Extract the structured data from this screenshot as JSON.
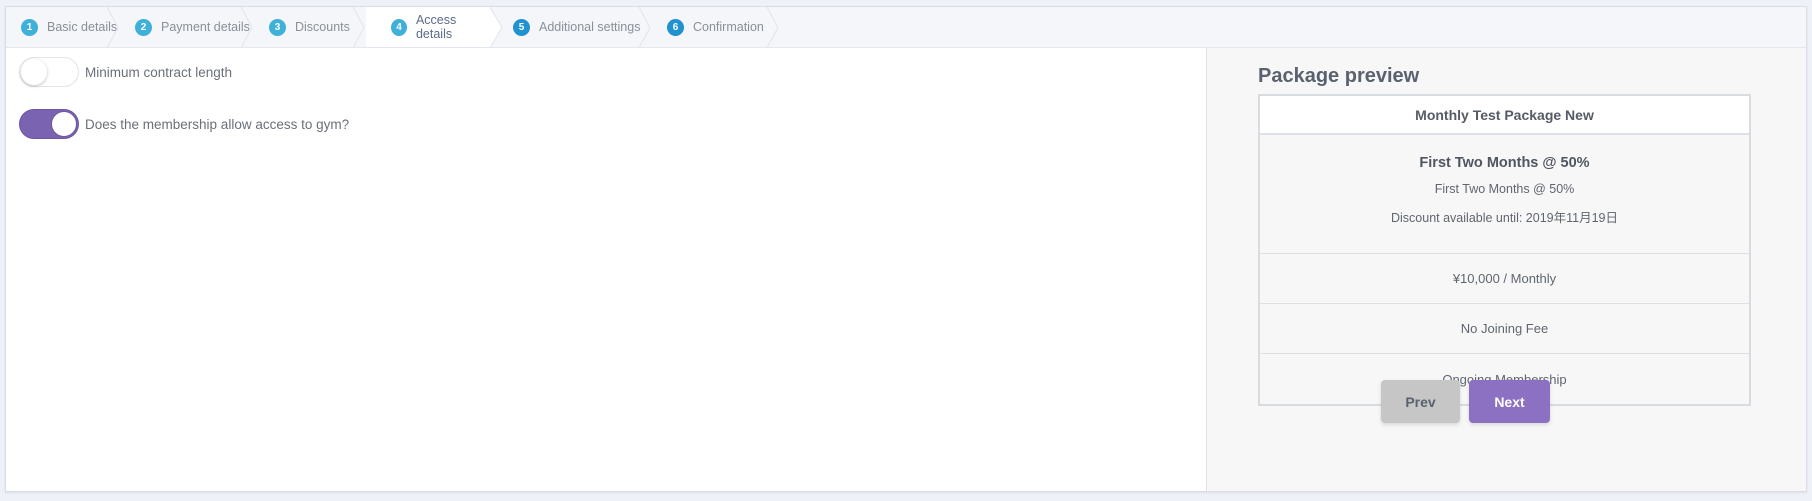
{
  "stepper": {
    "steps": [
      {
        "number": "1",
        "label": "Basic details",
        "state": "done"
      },
      {
        "number": "2",
        "label": "Payment details",
        "state": "done"
      },
      {
        "number": "3",
        "label": "Discounts",
        "state": "done"
      },
      {
        "number": "4",
        "label": "Access details",
        "state": "active"
      },
      {
        "number": "5",
        "label": "Additional settings",
        "state": "upcoming"
      },
      {
        "number": "6",
        "label": "Confirmation",
        "state": "upcoming"
      }
    ]
  },
  "form": {
    "min_contract": {
      "label": "Minimum contract length",
      "checked": false
    },
    "gym_access": {
      "label": "Does the membership allow access to gym?",
      "checked": true
    }
  },
  "preview": {
    "title": "Package preview",
    "package_name": "Monthly Test Package New",
    "discount_title": "First Two Months @ 50%",
    "discount_subtitle": "First Two Months @ 50%",
    "discount_until": "Discount available until: 2019年11月19日",
    "price": "¥10,000 / Monthly",
    "joining_fee": "No Joining Fee",
    "membership_type": "Ongoing Membership"
  },
  "buttons": {
    "prev": "Prev",
    "next": "Next"
  },
  "colors": {
    "accent": "#8c71c2",
    "toggle_on": "#7a63b0",
    "step_badge": "#3fb0d9",
    "step_badge_upcoming": "#1f92cf"
  }
}
